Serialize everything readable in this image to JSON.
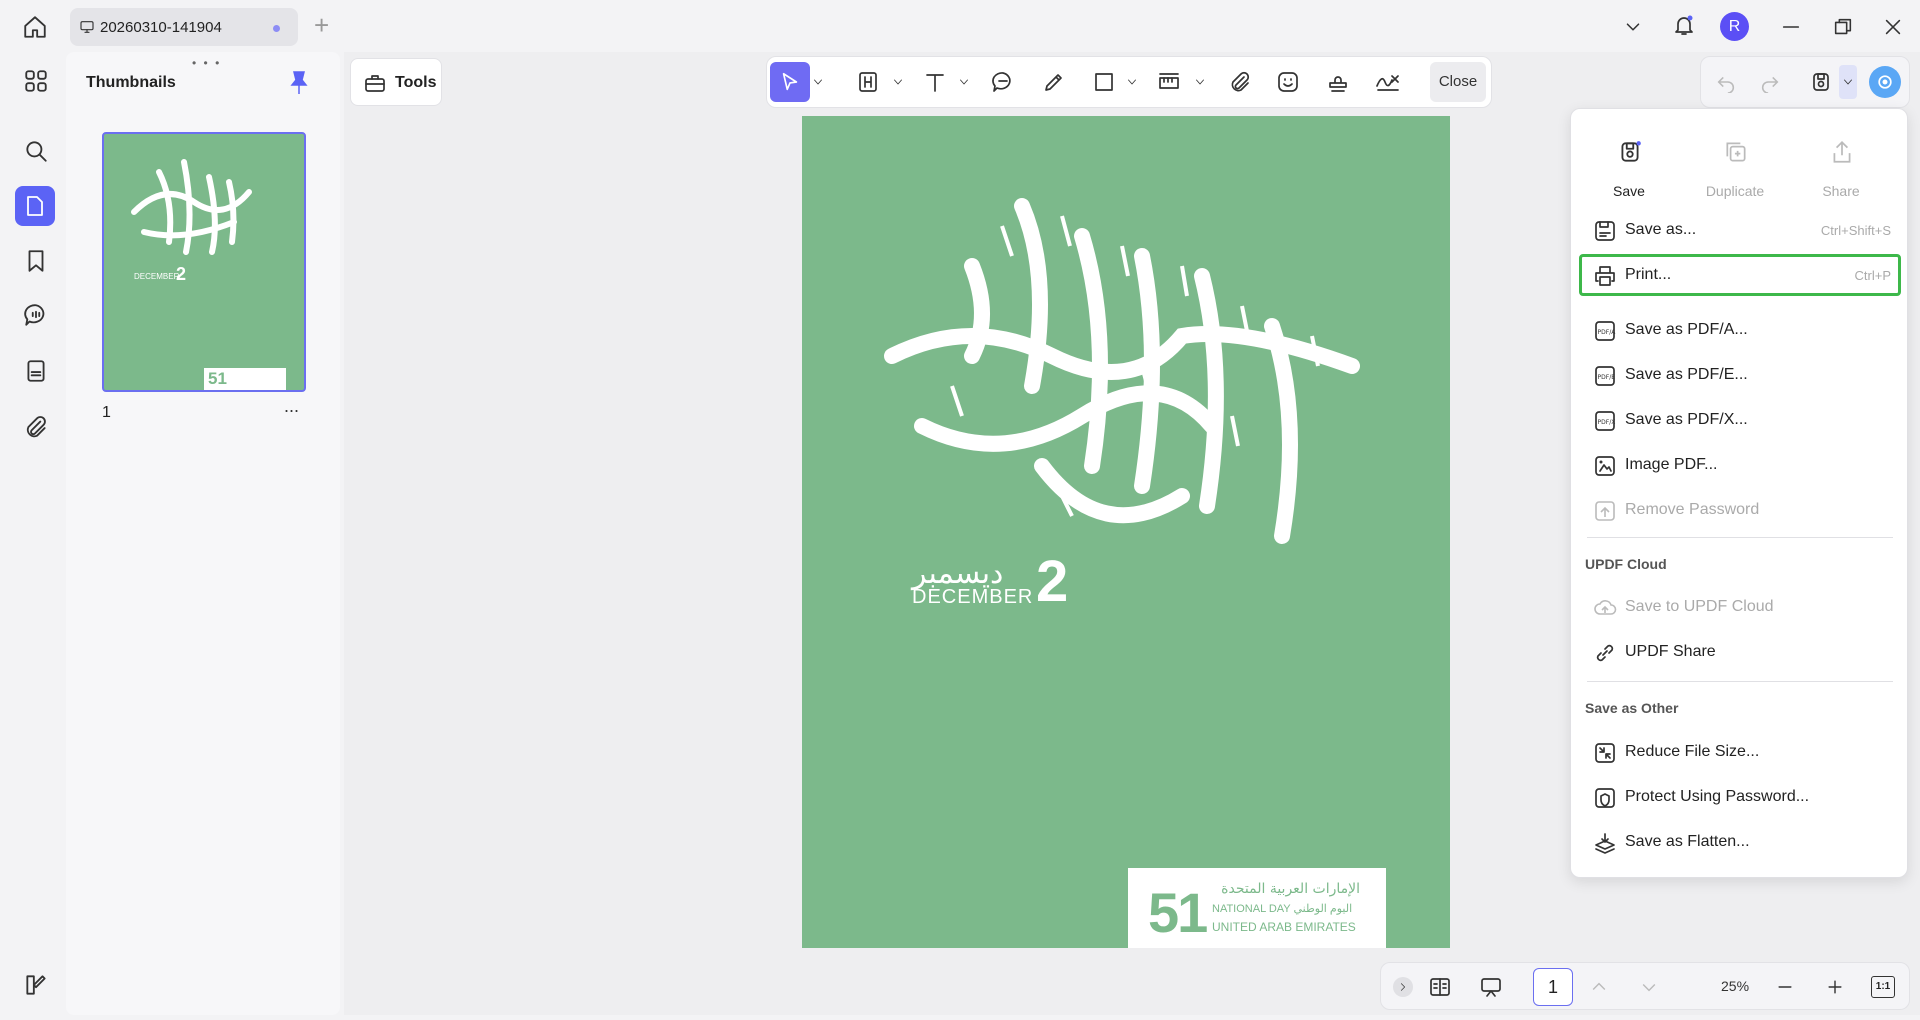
{
  "titlebar": {
    "tab_title": "20260310-141904",
    "new_tab": "+",
    "avatar_initial": "R"
  },
  "thumbnails": {
    "title": "Thumbnails",
    "page_number": "1",
    "more": "..."
  },
  "toolbar": {
    "tools_label": "Tools",
    "close_label": "Close"
  },
  "document": {
    "arabic_title": "اليوم الوطني",
    "date_arabic": "ديسمبر",
    "date_english": "DECEMBER",
    "date_number": "2",
    "badge_number": "51",
    "badge_line1": "الإمارات العربية المتحدة",
    "badge_line2": "NATIONAL DAY اليوم الوطني",
    "badge_line3": "UNITED ARAB EMIRATES"
  },
  "menu": {
    "top_actions": [
      {
        "label": "Save",
        "enabled": true
      },
      {
        "label": "Duplicate",
        "enabled": false
      },
      {
        "label": "Share",
        "enabled": false
      }
    ],
    "items": [
      {
        "label": "Save as...",
        "shortcut": "Ctrl+Shift+S",
        "icon": "save-as-icon",
        "enabled": true
      },
      {
        "label": "Print...",
        "shortcut": "Ctrl+P",
        "icon": "printer-icon",
        "enabled": true,
        "highlighted": true
      },
      {
        "label": "Save as PDF/A...",
        "icon": "pdfa-icon",
        "enabled": true
      },
      {
        "label": "Save as PDF/E...",
        "icon": "pdfe-icon",
        "enabled": true
      },
      {
        "label": "Save as PDF/X...",
        "icon": "pdfx-icon",
        "enabled": true
      },
      {
        "label": "Image PDF...",
        "icon": "image-pdf-icon",
        "enabled": true
      },
      {
        "label": "Remove Password",
        "icon": "remove-password-icon",
        "enabled": false
      }
    ],
    "cloud_section": "UPDF Cloud",
    "cloud_items": [
      {
        "label": "Save to UPDF Cloud",
        "icon": "cloud-upload-icon",
        "enabled": false
      },
      {
        "label": "UPDF Share",
        "icon": "link-icon",
        "enabled": true
      }
    ],
    "other_section": "Save as Other",
    "other_items": [
      {
        "label": "Reduce File Size...",
        "icon": "compress-icon",
        "enabled": true
      },
      {
        "label": "Protect Using Password...",
        "icon": "shield-icon",
        "enabled": true
      },
      {
        "label": "Save as Flatten...",
        "icon": "flatten-icon",
        "enabled": true
      }
    ]
  },
  "bottombar": {
    "page": "1",
    "zoom": "25%",
    "fit": "1:1"
  },
  "colors": {
    "accent": "#5b63f5",
    "page_green": "#7cb98b",
    "highlight": "#3db84a"
  }
}
